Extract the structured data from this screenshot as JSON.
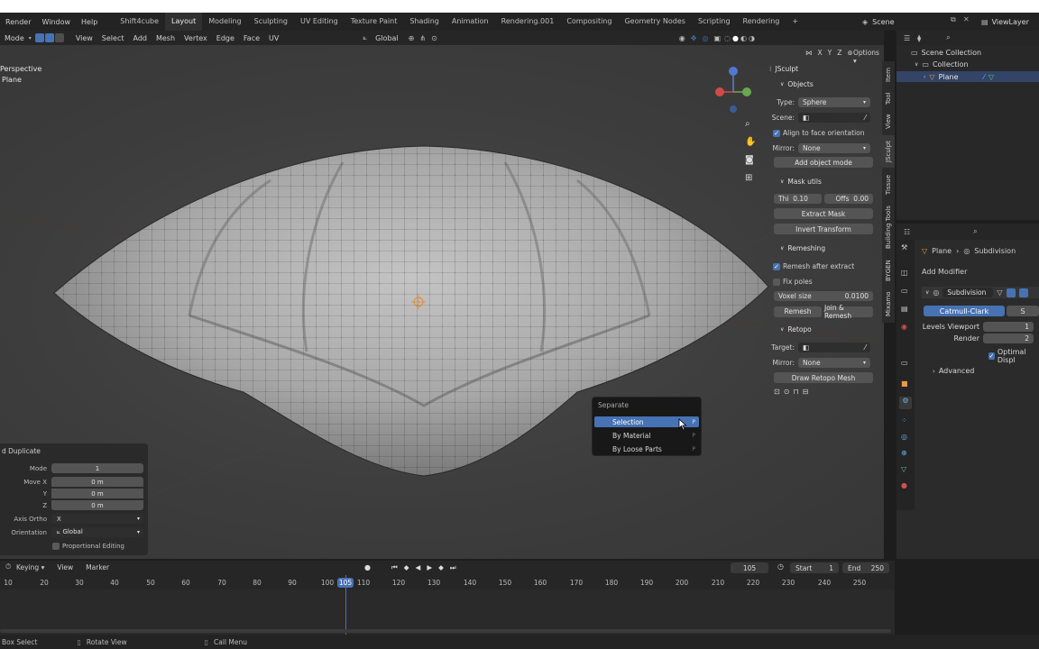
{
  "topbar": {
    "menus": [
      "Render",
      "Window",
      "Help"
    ],
    "workspaces": [
      "Shift4cube",
      "Layout",
      "Modeling",
      "Sculpting",
      "UV Editing",
      "Texture Paint",
      "Shading",
      "Animation",
      "Rendering.001",
      "Compositing",
      "Geometry Nodes",
      "Scripting",
      "Rendering"
    ],
    "active_workspace": "Layout",
    "scene_label": "Scene",
    "viewlayer_label": "ViewLayer"
  },
  "header3d": {
    "mode": "Mode",
    "menus": [
      "View",
      "Select",
      "Add",
      "Mesh",
      "Vertex",
      "Edge",
      "Face",
      "UV"
    ],
    "transform": "Global",
    "axes": [
      "X",
      "Y",
      "Z"
    ],
    "options": "Options"
  },
  "viewport": {
    "view_name": "Perspective",
    "object_name": "Plane"
  },
  "npanel": {
    "header": "JSculpt",
    "objects_title": "Objects",
    "type_label": "Type:",
    "type_value": "Sphere",
    "scene_label": "Scene:",
    "align_label": "Align to face orientation",
    "mirror_label": "Mirror:",
    "mirror_value": "None",
    "add_object_btn": "Add object mode",
    "mask_title": "Mask utils",
    "thi_label": "Thi",
    "thi_value": "0.10",
    "offs_label": "Offs",
    "offs_value": "0.00",
    "extract_mask_btn": "Extract Mask",
    "invert_transform_btn": "Invert Transform",
    "remeshing_title": "Remeshing",
    "remesh_after_label": "Remesh after extract",
    "fix_poles_label": "Fix poles",
    "voxel_label": "Voxel size",
    "voxel_value": "0.0100",
    "remesh_btn": "Remesh",
    "join_remesh_btn": "Join & Remesh",
    "retopo_title": "Retopo",
    "target_label": "Target:",
    "mirror2_label": "Mirror:",
    "mirror2_value": "None",
    "draw_retopo_btn": "Draw Retopo Mesh"
  },
  "vtabs": [
    "Item",
    "Tool",
    "View",
    "JSculpt",
    "Tissue",
    "Building Tools",
    "BYGEN",
    "Mixamo"
  ],
  "outliner": {
    "scene_collection": "Scene Collection",
    "collection": "Collection",
    "plane": "Plane"
  },
  "properties": {
    "breadcrumb_obj": "Plane",
    "breadcrumb_mod": "Subdivision",
    "add_modifier": "Add Modifier",
    "modifier_name": "Subdivision",
    "catmull": "Catmull-Clark",
    "simple": "S",
    "levels_viewport_label": "Levels Viewport",
    "levels_viewport_value": "1",
    "render_label": "Render",
    "render_value": "2",
    "optimal_label": "Optimal Displ",
    "advanced": "Advanced"
  },
  "popup": {
    "title": "Separate",
    "items": [
      {
        "label": "Selection",
        "shortcut": "P"
      },
      {
        "label": "By Material",
        "shortcut": "P"
      },
      {
        "label": "By Loose Parts",
        "shortcut": "P"
      }
    ]
  },
  "redo": {
    "title": "d Duplicate",
    "mode_label": "Mode",
    "mode_value": "1",
    "movex_label": "Move X",
    "movex_value": "0 m",
    "y_label": "Y",
    "y_value": "0 m",
    "z_label": "Z",
    "z_value": "0 m",
    "axis_label": "Axis Ortho",
    "axis_value": "X",
    "orient_label": "Orientation",
    "orient_value": "Global",
    "prop_label": "Proportional Editing"
  },
  "timeline": {
    "menus": [
      "Keying",
      "View",
      "Marker"
    ],
    "current_frame": "105",
    "start_label": "Start",
    "start_value": "1",
    "end_label": "End",
    "end_value": "250",
    "ticks": [
      "10",
      "20",
      "30",
      "40",
      "50",
      "60",
      "70",
      "80",
      "90",
      "100",
      "105",
      "110",
      "120",
      "130",
      "140",
      "150",
      "160",
      "170",
      "180",
      "190",
      "200",
      "210",
      "220",
      "230",
      "240",
      "250"
    ]
  },
  "statusbar": {
    "items": [
      "Box Select",
      "Rotate View",
      "Call Menu"
    ]
  },
  "colors": {
    "accent": "#4772b3",
    "bg": "#1d1d1d",
    "panel": "#2b2b2b"
  }
}
